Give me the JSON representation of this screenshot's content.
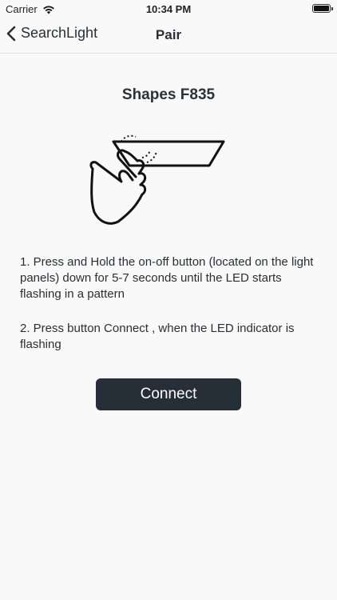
{
  "status_bar": {
    "carrier": "Carrier",
    "time": "10:34 PM",
    "wifi_icon": "wifi-icon",
    "battery_icon": "battery-icon"
  },
  "nav": {
    "back_label": "SearchLight",
    "back_icon": "chevron-left-icon",
    "title": "Pair"
  },
  "device": {
    "name": "Shapes F835",
    "illustration_icon": "hand-press-panel-icon"
  },
  "instructions": [
    "1. Press and Hold the on-off button (located on the light panels) down for 5-7 seconds until the LED starts flashing in a pattern",
    "2. Press button Connect , when the LED indicator is flashing"
  ],
  "connect_button": {
    "label": "Connect",
    "background": "#262e38",
    "text_color": "#ffffff"
  }
}
